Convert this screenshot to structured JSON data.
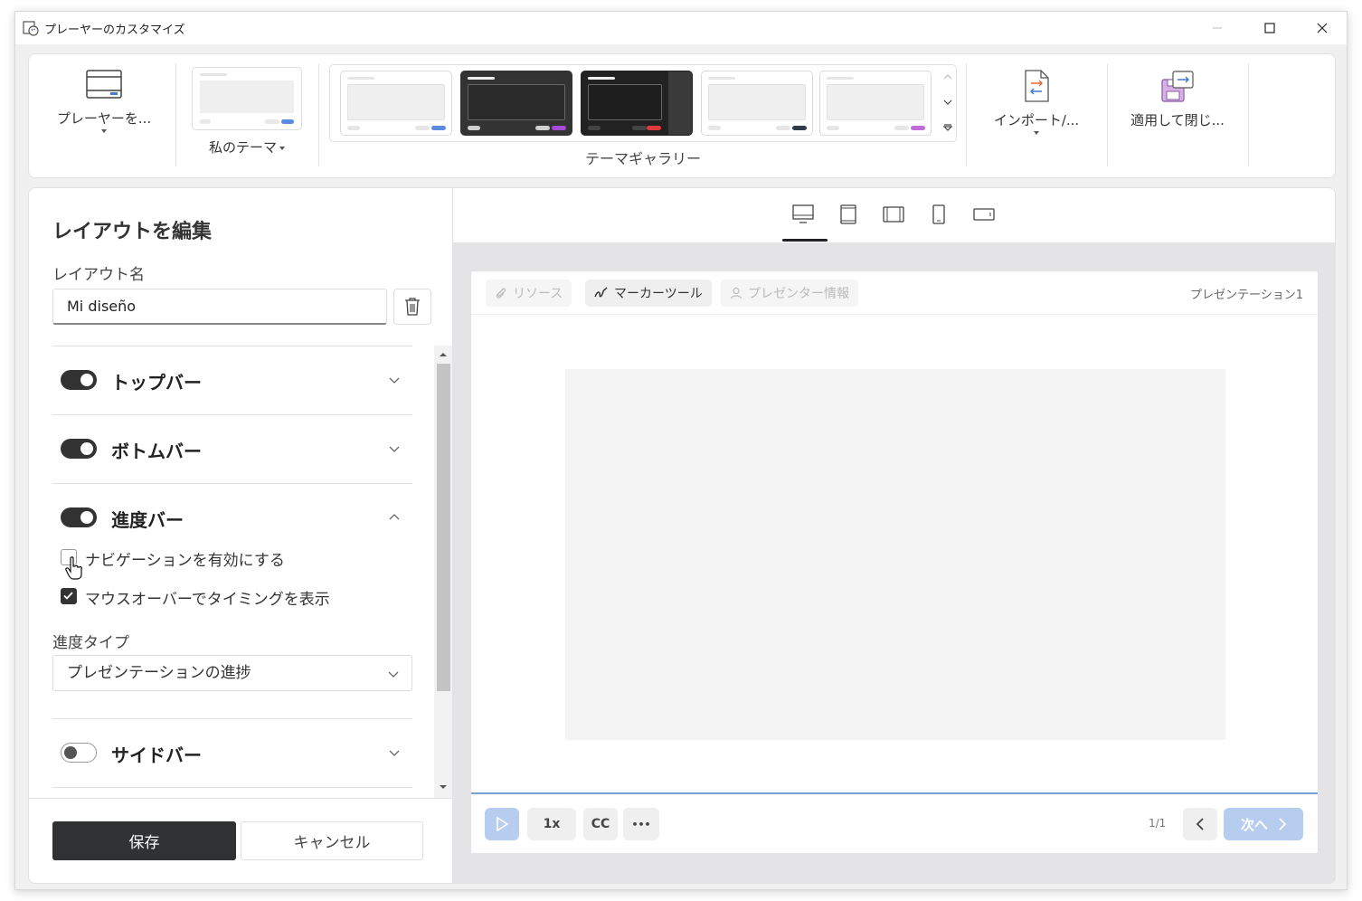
{
  "window": {
    "title": "プレーヤーのカスタマイズ"
  },
  "ribbon": {
    "player_button": "プレーヤーを...",
    "my_theme": "私のテーマ",
    "gallery_label": "テーマギャラリー",
    "import_button": "インポート/...",
    "apply_close_button": "適用して閉じ..."
  },
  "gallery_themes": [
    {
      "bg": "#ffffff",
      "screen": "#efefef",
      "bar": "#e6e6e6",
      "a": "#e6e6e6",
      "b": "#5b8be0"
    },
    {
      "bg": "#333333",
      "screen": "#2a2a2a",
      "bar": "#eeeeee",
      "a": "#cfcfcf",
      "b": "#a64ad8"
    },
    {
      "bg": "#222222",
      "screen": "#1e1e1e",
      "bar": "#eeeeee",
      "a": "#444444",
      "b": "#e0393e"
    },
    {
      "bg": "#ffffff",
      "screen": "#efefef",
      "bar": "#e6e6e6",
      "a": "#e6e6e6",
      "b": "#333b48"
    },
    {
      "bg": "#ffffff",
      "screen": "#efefef",
      "bar": "#e6e6e6",
      "a": "#e6e6e6",
      "b": "#c16bd9"
    }
  ],
  "left": {
    "heading": "レイアウトを編集",
    "layout_name_label": "レイアウト名",
    "layout_name_value": "Mi diseño",
    "sections": {
      "topbar": {
        "label": "トップバー",
        "enabled": true
      },
      "bottombar": {
        "label": "ボトムバー",
        "enabled": true
      },
      "progressbar": {
        "label": "進度バー",
        "enabled": true
      },
      "sidebar": {
        "label": "サイドバー",
        "enabled": false
      }
    },
    "checkbox_navigation": {
      "label": "ナビゲーションを有効にする",
      "checked": false
    },
    "checkbox_timing": {
      "label": "マウスオーバーでタイミングを表示",
      "checked": true
    },
    "progress_type_label": "進度タイプ",
    "progress_type_value": "プレゼンテーションの進捗",
    "save": "保存",
    "cancel": "キャンセル"
  },
  "preview": {
    "top_resources": "リソース",
    "top_marker": "マーカーツール",
    "top_presenter": "プレゼンター情報",
    "presentation_title": "プレゼンテーション1",
    "speed": "1x",
    "cc": "CC",
    "more": "•••",
    "page": "1/1",
    "next": "次へ"
  },
  "colors": {
    "accent": "#2f3133",
    "progress": "#7a9fd6",
    "next_btn": "#b7cdef"
  }
}
